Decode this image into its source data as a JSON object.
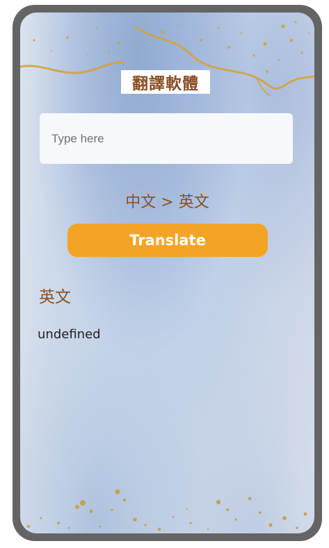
{
  "app": {
    "title": "翻譯軟體"
  },
  "input": {
    "placeholder": "Type here",
    "value": ""
  },
  "direction": {
    "label": "中文 > 英文"
  },
  "translate_button": {
    "label": "Translate"
  },
  "result": {
    "heading": "英文",
    "text": "undefined"
  },
  "colors": {
    "frame": "#646464",
    "accent_button": "#f4a424",
    "heading_brown": "#8a4f24",
    "gold_fleck": "#d4a23a",
    "watercolor_blue": "#8fa9d2"
  }
}
